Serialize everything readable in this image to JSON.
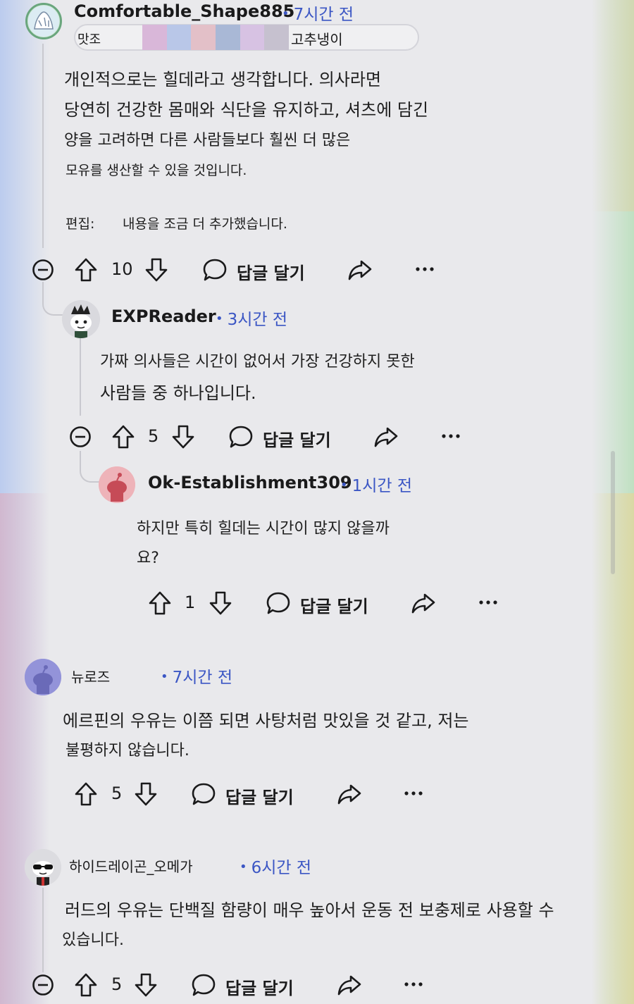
{
  "comments": [
    {
      "username": "Comfortable_Shape885",
      "time": "7시간 전",
      "flair": {
        "left": "맛조",
        "right": "고추냉이"
      },
      "body": [
        "개인적으로는 힐데라고 생각합니다. 의사라면",
        "당연히 건강한 몸매와 식단을 유지하고, 셔츠에 담긴",
        "양을 고려하면 다른 사람들보다 훨씬 더 많은",
        "모유를 생산할 수 있을 것입니다."
      ],
      "edit_label": "편집:",
      "edit_text": "내용을 조금 더 추가했습니다.",
      "votes": "10",
      "reply_label": "답글 달기"
    },
    {
      "username": "EXPReader",
      "time": "3시간 전",
      "body": [
        "가짜 의사들은 시간이 없어서 가장 건강하지 못한",
        "사람들 중 하나입니다."
      ],
      "votes": "5",
      "reply_label": "답글 달기"
    },
    {
      "username": "Ok-Establishment309",
      "time": "1시간 전",
      "body": [
        "하지만 특히 힐데는 시간이 많지 않을까",
        "요?"
      ],
      "votes": "1",
      "reply_label": "답글 달기"
    },
    {
      "username": "뉴로즈",
      "time": "7시간 전",
      "body": [
        "에르핀의 우유는 이쯤 되면 사탕처럼 맛있을 것 같고, 저는",
        "불평하지 않습니다."
      ],
      "votes": "5",
      "reply_label": "답글 달기"
    },
    {
      "username": "하이드레이곤_오메가",
      "time": "6시간 전",
      "body": [
        "러드의 우유는 단백질 함량이 매우 높아서 운동 전 보충제로 사용할 수",
        "있습니다."
      ],
      "votes": "5",
      "reply_label": "답글 달기"
    }
  ],
  "icons": {
    "collapse": "collapse-minus-icon",
    "upvote": "upvote-arrow-icon",
    "downvote": "downvote-arrow-icon",
    "reply": "speech-bubble-icon",
    "share": "share-arrow-icon",
    "more": "more-dots-icon"
  },
  "colors": {
    "link_blue": "#3b56c4",
    "text": "#1a1a1b",
    "thread_line": "#c9c9cf"
  }
}
